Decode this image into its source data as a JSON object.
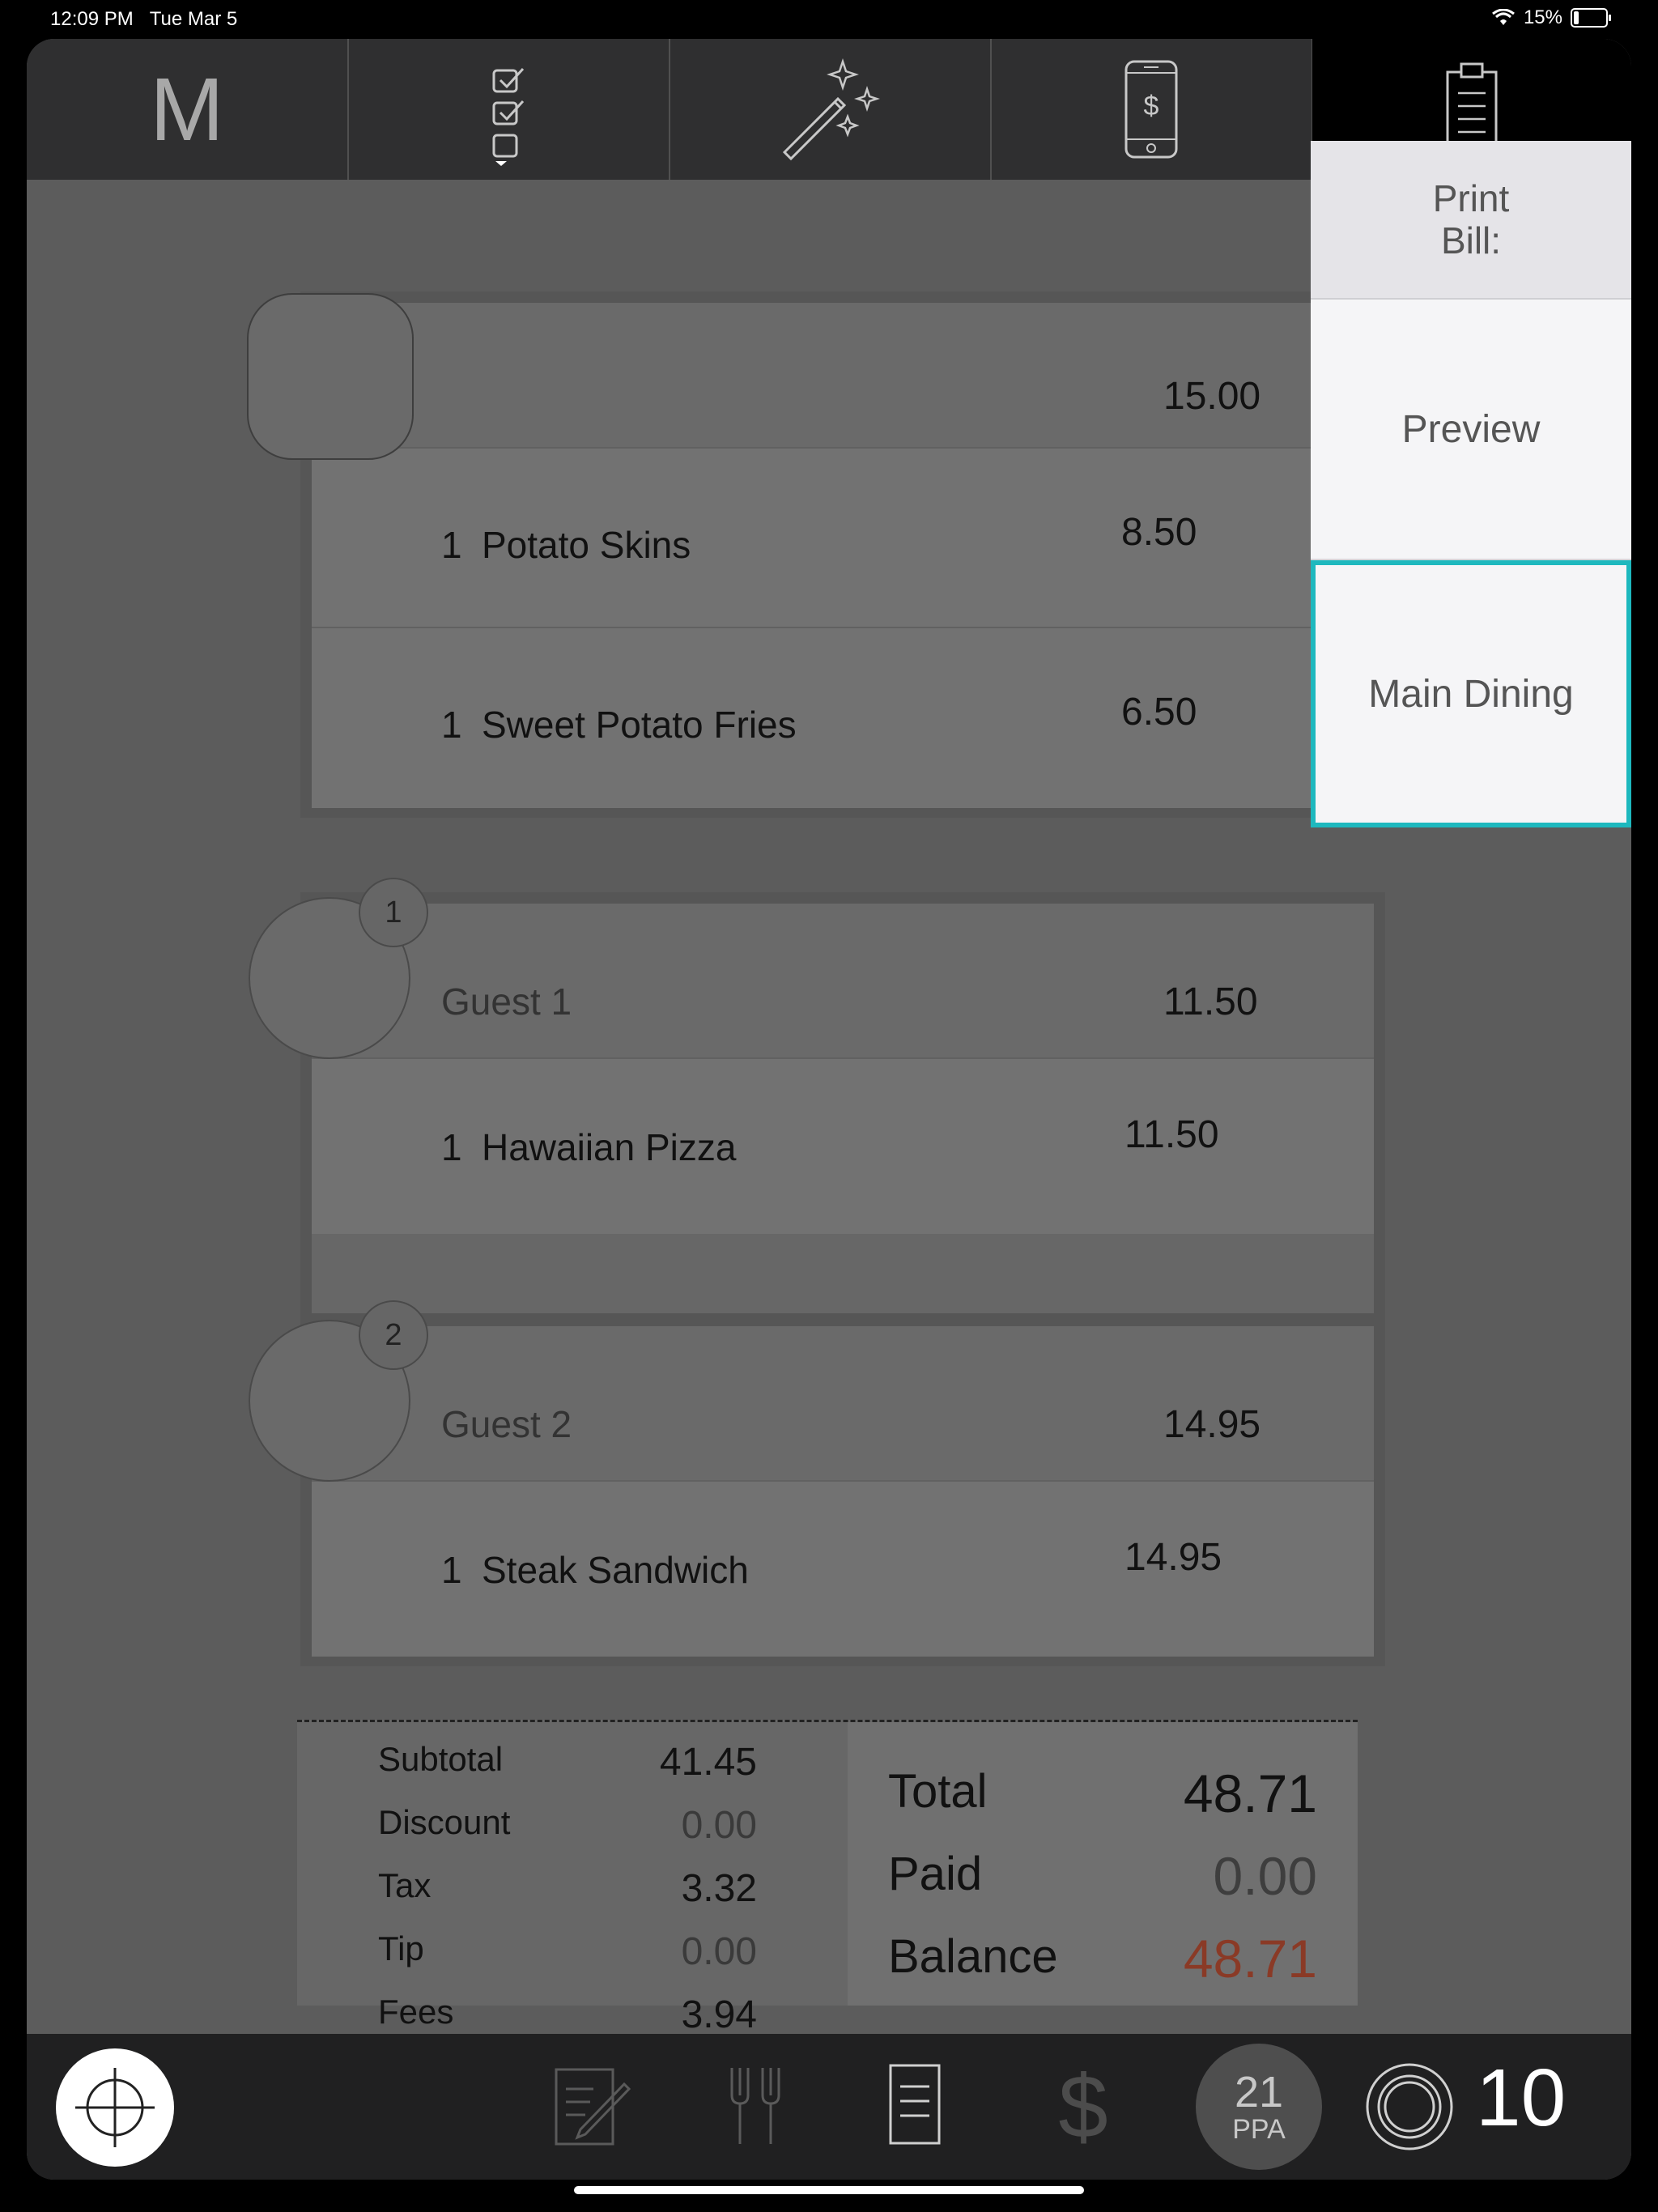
{
  "status_bar": {
    "time": "12:09 PM",
    "date": "Tue Mar 5",
    "battery": "15%",
    "battery_level": 0.15
  },
  "toolbar": {
    "logo": "M",
    "buttons": [
      "logo-icon",
      "checklist-icon",
      "magic-wand-icon",
      "mobile-pay-icon",
      "bill-icon"
    ]
  },
  "table_group": {
    "total": "15.00",
    "items": [
      {
        "qty": "1",
        "name": "Potato Skins",
        "price": "8.50"
      },
      {
        "qty": "1",
        "name": "Sweet Potato Fries",
        "price": "6.50"
      }
    ]
  },
  "guests": [
    {
      "badge": "1",
      "name": "Guest 1",
      "total": "11.50",
      "items": [
        {
          "qty": "1",
          "name": "Hawaiian Pizza",
          "price": "11.50"
        }
      ]
    },
    {
      "badge": "2",
      "name": "Guest 2",
      "total": "14.95",
      "items": [
        {
          "qty": "1",
          "name": "Steak Sandwich",
          "price": "14.95"
        }
      ]
    }
  ],
  "totals": {
    "subtotal_label": "Subtotal",
    "subtotal": "41.45",
    "discount_label": "Discount",
    "discount": "0.00",
    "tax_label": "Tax",
    "tax": "3.32",
    "tip_label": "Tip",
    "tip": "0.00",
    "fees_label": "Fees",
    "fees": "3.94",
    "total_label": "Total",
    "total": "48.71",
    "paid_label": "Paid",
    "paid": "0.00",
    "balance_label": "Balance",
    "balance": "48.71"
  },
  "print_menu": {
    "header_line1": "Print",
    "header_line2": "Bill:",
    "options": [
      "Preview",
      "Main Dining"
    ],
    "selected": "Main Dining",
    "accent": "#1eb8be"
  },
  "bottom_bar": {
    "ppa_number": "21",
    "ppa_label": "PPA",
    "seat_count": "10",
    "icons": [
      "locate-icon",
      "notes-icon",
      "fork-icon",
      "bill-icon",
      "dollar-icon",
      "plate-icon"
    ]
  },
  "colors": {
    "balance_red": "#8a3a26",
    "panel_bg": "#5c5c5c"
  }
}
